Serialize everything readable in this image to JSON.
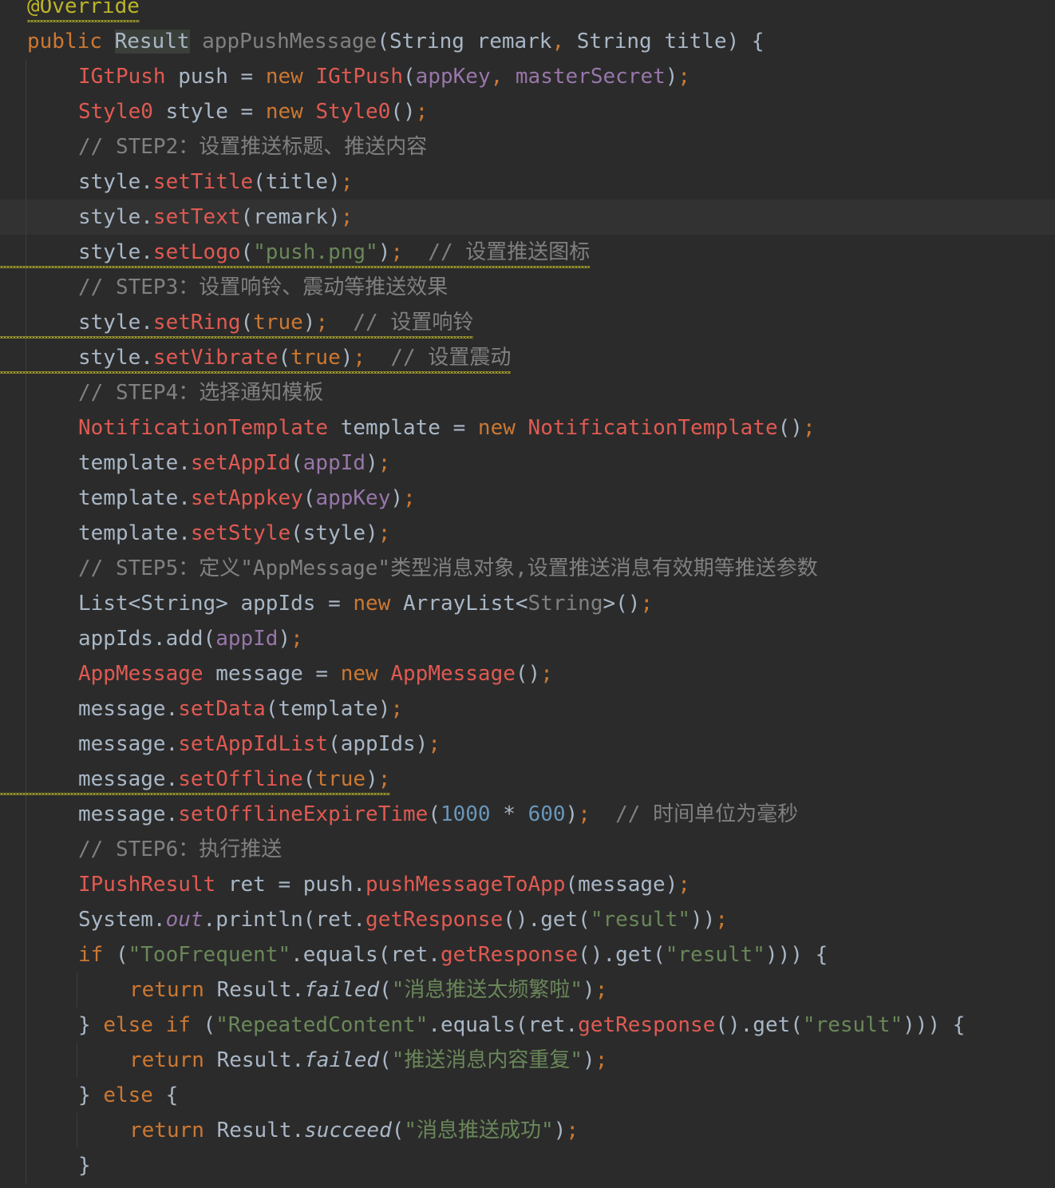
{
  "colors": {
    "background": "#2b2b2b",
    "caret_line": "#323232",
    "keyword": "#cc7832",
    "type": "#e05a52",
    "field": "#9876aa",
    "string": "#6a8759",
    "number": "#6897bb",
    "comment": "#808080",
    "annotation": "#bbb529",
    "default": "#a9b7c6"
  },
  "editor": {
    "language": "java",
    "method": "appPushMessage",
    "caret_line": 6,
    "warning_lines": [
      0,
      7,
      9,
      10,
      22
    ],
    "lines": [
      {
        "indent": 0,
        "tokens": [
          {
            "t": "@Override",
            "c": "ann"
          }
        ]
      },
      {
        "indent": 0,
        "tokens": [
          {
            "t": "public ",
            "c": "kw"
          },
          {
            "t": "Result",
            "c": "hl"
          },
          {
            "t": " appPushMessage",
            "c": "gen"
          },
          {
            "t": "(String remark"
          },
          {
            "t": ",",
            "c": "punc"
          },
          {
            "t": " String title) {"
          }
        ]
      },
      {
        "indent": 1,
        "tokens": [
          {
            "t": "IGtPush",
            "c": "type"
          },
          {
            "t": " push = "
          },
          {
            "t": "new ",
            "c": "kw"
          },
          {
            "t": "IGtPush",
            "c": "type"
          },
          {
            "t": "("
          },
          {
            "t": "appKey",
            "c": "field"
          },
          {
            "t": ", ",
            "c": "punc"
          },
          {
            "t": "masterSecret",
            "c": "field"
          },
          {
            "t": ")"
          },
          {
            "t": ";",
            "c": "punc"
          }
        ]
      },
      {
        "indent": 1,
        "tokens": [
          {
            "t": "Style0",
            "c": "type"
          },
          {
            "t": " style = "
          },
          {
            "t": "new ",
            "c": "kw"
          },
          {
            "t": "Style0",
            "c": "type"
          },
          {
            "t": "()"
          },
          {
            "t": ";",
            "c": "punc"
          }
        ]
      },
      {
        "indent": 1,
        "tokens": [
          {
            "t": "// STEP2：设置推送标题、推送内容",
            "c": "cmt"
          }
        ]
      },
      {
        "indent": 1,
        "tokens": [
          {
            "t": "style."
          },
          {
            "t": "setTitle",
            "c": "meth"
          },
          {
            "t": "(title)"
          },
          {
            "t": ";",
            "c": "punc"
          }
        ]
      },
      {
        "indent": 1,
        "tokens": [
          {
            "t": "style."
          },
          {
            "t": "setText",
            "c": "meth"
          },
          {
            "t": "(remark)"
          },
          {
            "t": ";",
            "c": "punc"
          }
        ]
      },
      {
        "indent": 1,
        "tokens": [
          {
            "t": "style."
          },
          {
            "t": "setLogo",
            "c": "meth"
          },
          {
            "t": "("
          },
          {
            "t": "\"push.png\"",
            "c": "str"
          },
          {
            "t": ")"
          },
          {
            "t": ";",
            "c": "punc"
          },
          {
            "t": "  // 设置推送图标",
            "c": "cmt"
          }
        ]
      },
      {
        "indent": 1,
        "tokens": [
          {
            "t": "// STEP3：设置响铃、震动等推送效果",
            "c": "cmt"
          }
        ]
      },
      {
        "indent": 1,
        "tokens": [
          {
            "t": "style."
          },
          {
            "t": "setRing",
            "c": "meth"
          },
          {
            "t": "("
          },
          {
            "t": "true",
            "c": "kw"
          },
          {
            "t": ")"
          },
          {
            "t": ";",
            "c": "punc"
          },
          {
            "t": "  // 设置响铃",
            "c": "cmt"
          }
        ]
      },
      {
        "indent": 1,
        "tokens": [
          {
            "t": "style."
          },
          {
            "t": "setVibrate",
            "c": "meth"
          },
          {
            "t": "("
          },
          {
            "t": "true",
            "c": "kw"
          },
          {
            "t": ")"
          },
          {
            "t": ";",
            "c": "punc"
          },
          {
            "t": "  // 设置震动",
            "c": "cmt"
          }
        ]
      },
      {
        "indent": 1,
        "tokens": [
          {
            "t": "// STEP4：选择通知模板",
            "c": "cmt"
          }
        ]
      },
      {
        "indent": 1,
        "tokens": [
          {
            "t": "NotificationTemplate",
            "c": "type"
          },
          {
            "t": " template = "
          },
          {
            "t": "new ",
            "c": "kw"
          },
          {
            "t": "NotificationTemplate",
            "c": "type"
          },
          {
            "t": "()"
          },
          {
            "t": ";",
            "c": "punc"
          }
        ]
      },
      {
        "indent": 1,
        "tokens": [
          {
            "t": "template."
          },
          {
            "t": "setAppId",
            "c": "meth"
          },
          {
            "t": "("
          },
          {
            "t": "appId",
            "c": "field"
          },
          {
            "t": ")"
          },
          {
            "t": ";",
            "c": "punc"
          }
        ]
      },
      {
        "indent": 1,
        "tokens": [
          {
            "t": "template."
          },
          {
            "t": "setAppkey",
            "c": "meth"
          },
          {
            "t": "("
          },
          {
            "t": "appKey",
            "c": "field"
          },
          {
            "t": ")"
          },
          {
            "t": ";",
            "c": "punc"
          }
        ]
      },
      {
        "indent": 1,
        "tokens": [
          {
            "t": "template."
          },
          {
            "t": "setStyle",
            "c": "meth"
          },
          {
            "t": "(style)"
          },
          {
            "t": ";",
            "c": "punc"
          }
        ]
      },
      {
        "indent": 1,
        "tokens": [
          {
            "t": "// STEP5：定义\"AppMessage\"类型消息对象,设置推送消息有效期等推送参数",
            "c": "cmt"
          }
        ]
      },
      {
        "indent": 1,
        "tokens": [
          {
            "t": "List<String> appIds = "
          },
          {
            "t": "new ",
            "c": "kw"
          },
          {
            "t": "ArrayList<"
          },
          {
            "t": "String",
            "c": "cmt"
          },
          {
            "t": ">()"
          },
          {
            "t": ";",
            "c": "punc"
          }
        ]
      },
      {
        "indent": 1,
        "tokens": [
          {
            "t": "appIds.add("
          },
          {
            "t": "appId",
            "c": "field"
          },
          {
            "t": ")"
          },
          {
            "t": ";",
            "c": "punc"
          }
        ]
      },
      {
        "indent": 1,
        "tokens": [
          {
            "t": "AppMessage",
            "c": "type"
          },
          {
            "t": " message = "
          },
          {
            "t": "new ",
            "c": "kw"
          },
          {
            "t": "AppMessage",
            "c": "type"
          },
          {
            "t": "()"
          },
          {
            "t": ";",
            "c": "punc"
          }
        ]
      },
      {
        "indent": 1,
        "tokens": [
          {
            "t": "message."
          },
          {
            "t": "setData",
            "c": "meth"
          },
          {
            "t": "(template)"
          },
          {
            "t": ";",
            "c": "punc"
          }
        ]
      },
      {
        "indent": 1,
        "tokens": [
          {
            "t": "message."
          },
          {
            "t": "setAppIdList",
            "c": "meth"
          },
          {
            "t": "(appIds)"
          },
          {
            "t": ";",
            "c": "punc"
          }
        ]
      },
      {
        "indent": 1,
        "tokens": [
          {
            "t": "message."
          },
          {
            "t": "setOffline",
            "c": "meth"
          },
          {
            "t": "("
          },
          {
            "t": "true",
            "c": "kw"
          },
          {
            "t": ")"
          },
          {
            "t": ";",
            "c": "punc"
          }
        ]
      },
      {
        "indent": 1,
        "tokens": [
          {
            "t": "message."
          },
          {
            "t": "setOfflineExpireTime",
            "c": "meth"
          },
          {
            "t": "("
          },
          {
            "t": "1000",
            "c": "num"
          },
          {
            "t": " * "
          },
          {
            "t": "600",
            "c": "num"
          },
          {
            "t": ")"
          },
          {
            "t": ";",
            "c": "punc"
          },
          {
            "t": "  // 时间单位为毫秒",
            "c": "cmt"
          }
        ]
      },
      {
        "indent": 1,
        "tokens": [
          {
            "t": "// STEP6：执行推送",
            "c": "cmt"
          }
        ]
      },
      {
        "indent": 1,
        "tokens": [
          {
            "t": "IPushResult",
            "c": "type"
          },
          {
            "t": " ret = push."
          },
          {
            "t": "pushMessageToApp",
            "c": "meth"
          },
          {
            "t": "(message)"
          },
          {
            "t": ";",
            "c": "punc"
          }
        ]
      },
      {
        "indent": 1,
        "tokens": [
          {
            "t": "System."
          },
          {
            "t": "out",
            "c": "field-it"
          },
          {
            "t": ".println(ret."
          },
          {
            "t": "getResponse",
            "c": "meth"
          },
          {
            "t": "().get("
          },
          {
            "t": "\"result\"",
            "c": "str"
          },
          {
            "t": "))"
          },
          {
            "t": ";",
            "c": "punc"
          }
        ]
      },
      {
        "indent": 1,
        "tokens": [
          {
            "t": "if ",
            "c": "kw"
          },
          {
            "t": "("
          },
          {
            "t": "\"TooFrequent\"",
            "c": "str"
          },
          {
            "t": ".equals(ret."
          },
          {
            "t": "getResponse",
            "c": "meth"
          },
          {
            "t": "().get("
          },
          {
            "t": "\"result\"",
            "c": "str"
          },
          {
            "t": "))) {"
          }
        ]
      },
      {
        "indent": 2,
        "tokens": [
          {
            "t": "return ",
            "c": "kw"
          },
          {
            "t": "Result."
          },
          {
            "t": "failed",
            "c": "it"
          },
          {
            "t": "("
          },
          {
            "t": "\"消息推送太频繁啦\"",
            "c": "str"
          },
          {
            "t": ")"
          },
          {
            "t": ";",
            "c": "punc"
          }
        ]
      },
      {
        "indent": 1,
        "tokens": [
          {
            "t": "} "
          },
          {
            "t": "else if ",
            "c": "kw"
          },
          {
            "t": "("
          },
          {
            "t": "\"RepeatedContent\"",
            "c": "str"
          },
          {
            "t": ".equals(ret."
          },
          {
            "t": "getResponse",
            "c": "meth"
          },
          {
            "t": "().get("
          },
          {
            "t": "\"result\"",
            "c": "str"
          },
          {
            "t": "))) {"
          }
        ]
      },
      {
        "indent": 2,
        "tokens": [
          {
            "t": "return ",
            "c": "kw"
          },
          {
            "t": "Result."
          },
          {
            "t": "failed",
            "c": "it"
          },
          {
            "t": "("
          },
          {
            "t": "\"推送消息内容重复\"",
            "c": "str"
          },
          {
            "t": ")"
          },
          {
            "t": ";",
            "c": "punc"
          }
        ]
      },
      {
        "indent": 1,
        "tokens": [
          {
            "t": "} "
          },
          {
            "t": "else ",
            "c": "kw"
          },
          {
            "t": "{"
          }
        ]
      },
      {
        "indent": 2,
        "tokens": [
          {
            "t": "return ",
            "c": "kw"
          },
          {
            "t": "Result."
          },
          {
            "t": "succeed",
            "c": "it"
          },
          {
            "t": "("
          },
          {
            "t": "\"消息推送成功\"",
            "c": "str"
          },
          {
            "t": ")"
          },
          {
            "t": ";",
            "c": "punc"
          }
        ]
      },
      {
        "indent": 1,
        "tokens": [
          {
            "t": "}"
          }
        ]
      }
    ]
  }
}
